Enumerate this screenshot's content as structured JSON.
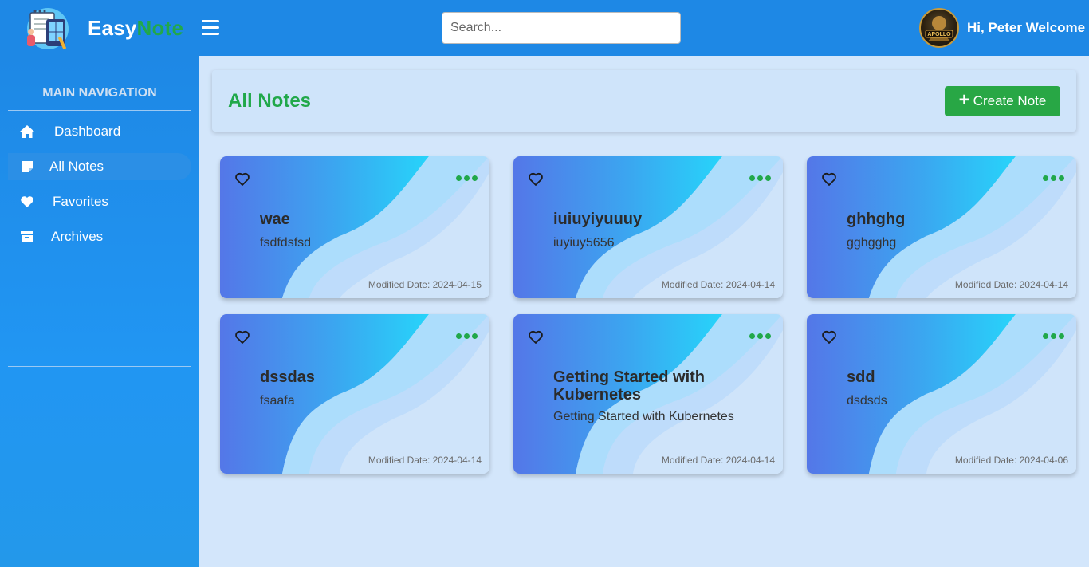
{
  "header": {
    "brand_part1": "Easy",
    "brand_part2": "Note",
    "search_placeholder": "Search...",
    "greeting": "Hi, Peter Welcome",
    "avatar_text": "APOLLO"
  },
  "sidebar": {
    "section_title": "MAIN NAVIGATION",
    "items": [
      {
        "label": "Dashboard",
        "icon": "home-icon"
      },
      {
        "label": "All Notes",
        "icon": "note-icon",
        "active": true
      },
      {
        "label": "Favorites",
        "icon": "heart-icon"
      },
      {
        "label": "Archives",
        "icon": "archive-icon"
      }
    ]
  },
  "main": {
    "title": "All Notes",
    "create_label": "Create Note",
    "date_prefix": "Modified Date:"
  },
  "notes": [
    {
      "title": "wae",
      "body": "fsdfdsfsd",
      "modified": "Modified Date: 2024-04-15"
    },
    {
      "title": "iuiuyiyuuuy",
      "body": "iuyiuy5656",
      "modified": "Modified Date: 2024-04-14"
    },
    {
      "title": "ghhghg",
      "body": "gghgghg",
      "modified": "Modified Date: 2024-04-14"
    },
    {
      "title": "dssdas",
      "body": "fsaafa",
      "modified": "Modified Date: 2024-04-14"
    },
    {
      "title": "Getting Started with Kubernetes",
      "body": "Getting Started with Kubernetes",
      "modified": "Modified Date: 2024-04-14"
    },
    {
      "title": "sdd",
      "body": "dsdsds",
      "modified": "Modified Date: 2024-04-06"
    }
  ],
  "colors": {
    "header_bg": "#1e88e5",
    "accent_green": "#28a745",
    "page_bg": "#d3e6fb"
  }
}
